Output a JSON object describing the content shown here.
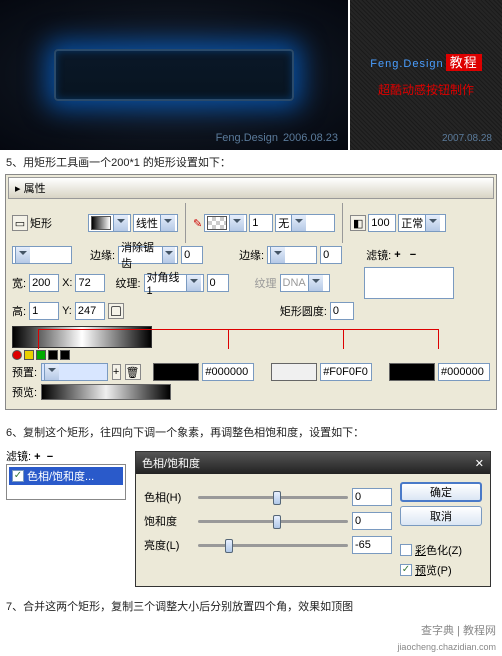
{
  "banner": {
    "left_brand": "Feng.Design",
    "left_date": "2006.08.23",
    "right_brand": "Feng.Design",
    "right_cn": "教程",
    "right_sub": "超酷动感按钮制作",
    "right_date": "2007.08.28"
  },
  "steps": {
    "s5": "5、用矩形工具画一个200*1 的矩形设置如下：",
    "s6": "6、复制这个矩形，往四向下调一个象素，再调整色相饱和度，设置如下：",
    "s7": "7、合并这两个矩形，复制三个调整大小后分别放置四个角，效果如顶图"
  },
  "panel": {
    "title": "属性",
    "shape_label": "矩形",
    "line_label": "线性",
    "edge1": "边缘:",
    "edge1_val": "消除锯齿",
    "texture": "纹理:",
    "texture_val": "对角线1",
    "tex_pct": "0",
    "stroke_width": "1",
    "stroke_style": "无",
    "edge2": "边缘:",
    "edge2_stroke": "0",
    "opacity": "100",
    "blend": "正常",
    "filter_label": "滤镜:",
    "dna_label": "纹理",
    "dna_val": "DNA",
    "round_label": "矩形圆度:",
    "round_val": "0",
    "w_label": "宽:",
    "w_val": "200",
    "h_label": "高:",
    "h_val": "1",
    "x_label": "X:",
    "x_val": "72",
    "y_label": "Y:",
    "y_val": "247",
    "preset_label": "预置:",
    "preview_label": "预览:",
    "hex1": "#000000",
    "hex2": "#F0F0F0",
    "hex3": "#000000"
  },
  "hsl": {
    "filter_label": "滤镜:",
    "filter_item": "色相/饱和度...",
    "title": "色相/饱和度",
    "hue_label": "色相(H)",
    "hue_val": "0",
    "sat_label": "饱和度",
    "sat_val": "0",
    "light_label": "亮度(L)",
    "light_val": "-65",
    "ok": "确定",
    "cancel": "取消",
    "colorize": "彩色化(Z)",
    "preview": "预览(P)"
  },
  "footer": {
    "site": "查字典 | 教程网",
    "url": "jiaocheng.chazidian.com"
  }
}
